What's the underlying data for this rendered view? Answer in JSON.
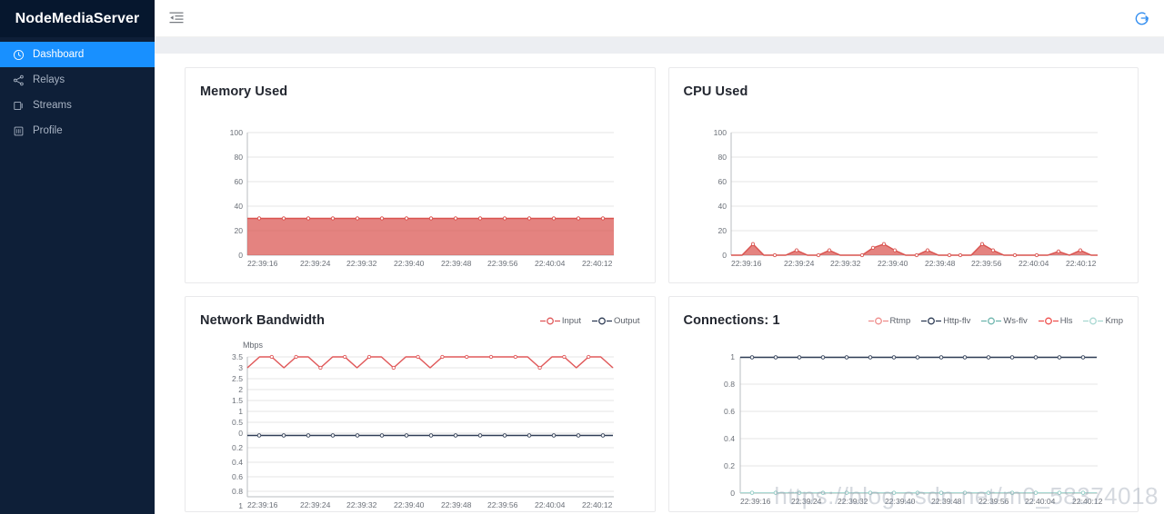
{
  "sidebar": {
    "brand": "NodeMediaServer",
    "items": [
      {
        "label": "Dashboard",
        "icon": "dashboard-icon",
        "active": true
      },
      {
        "label": "Relays",
        "icon": "share-icon",
        "active": false
      },
      {
        "label": "Streams",
        "icon": "window-icon",
        "active": false
      },
      {
        "label": "Profile",
        "icon": "id-card-icon",
        "active": false
      }
    ]
  },
  "topbar": {
    "collapse_icon": "menu-fold-icon",
    "logout_icon": "logout-icon",
    "accent_color": "#1890ff"
  },
  "watermark": "https://blog.csdn.net/m0_58374018",
  "colors": {
    "red": "#d9534f",
    "red_fill": "rgba(217,83,79,0.72)",
    "pink": "#ef8e8c",
    "navy": "#2f3d56",
    "teal": "#6fb6ae",
    "light_teal": "#a8d8d2",
    "orange_red": "#ef5350",
    "grid": "#e6e6e6",
    "sidebar_bg": "#0e1f38",
    "active_bg": "#1890ff"
  },
  "cards": [
    {
      "title": "Memory Used"
    },
    {
      "title": "CPU Used"
    },
    {
      "title": "Network Bandwidth"
    },
    {
      "title": "Connections: 1"
    }
  ],
  "chart_data": [
    {
      "id": "memory-used",
      "type": "area",
      "title": "Memory Used",
      "xlabel": "",
      "ylabel": "",
      "ylim": [
        0,
        100
      ],
      "yticks": [
        0,
        20,
        40,
        60,
        80,
        100
      ],
      "xtick_labels": [
        "22:39:16",
        "22:39:24",
        "22:39:32",
        "22:39:40",
        "22:39:48",
        "22:39:56",
        "22:40:04",
        "22:40:12"
      ],
      "grid": true,
      "legend": null,
      "series": [
        {
          "name": "Memory Used",
          "color": "#d9534f",
          "fill": "rgba(217,83,79,0.72)",
          "values": [
            30,
            30,
            30,
            30,
            30,
            30,
            30,
            30,
            30,
            30,
            30,
            30,
            30,
            30,
            30,
            30,
            30,
            30,
            30,
            30,
            30,
            30,
            30,
            30,
            30,
            30,
            30,
            30,
            30,
            30
          ]
        }
      ]
    },
    {
      "id": "cpu-used",
      "type": "area",
      "title": "CPU Used",
      "xlabel": "",
      "ylabel": "",
      "ylim": [
        0,
        100
      ],
      "yticks": [
        0,
        20,
        40,
        60,
        80,
        100
      ],
      "xtick_labels": [
        "22:39:16",
        "22:39:24",
        "22:39:32",
        "22:39:40",
        "22:39:48",
        "22:39:56",
        "22:40:04",
        "22:40:12"
      ],
      "grid": true,
      "legend": null,
      "series": [
        {
          "name": "CPU Used",
          "color": "#d9534f",
          "fill": "rgba(217,83,79,0.72)",
          "values": [
            0,
            0,
            0,
            9,
            0,
            0,
            4,
            0,
            0,
            4,
            0,
            0,
            0,
            6,
            9,
            4,
            0,
            0,
            4,
            0,
            0,
            0,
            0,
            9,
            4,
            0,
            0,
            0,
            0,
            0,
            3,
            0,
            4,
            0
          ]
        }
      ]
    },
    {
      "id": "network-bandwidth",
      "type": "line",
      "title": "Network Bandwidth",
      "xlabel": "",
      "ylabel": "Mbps",
      "yticks": [
        3.5,
        3,
        2.5,
        2,
        1.5,
        1,
        0.5,
        0,
        0.2,
        0.4,
        0.6,
        0.8,
        1
      ],
      "ytick_labels": [
        "3.5",
        "3",
        "2.5",
        "2",
        "1.5",
        "1",
        "0.5",
        "0",
        "0.2",
        "0.4",
        "0.6",
        "0.8",
        "1"
      ],
      "ylim": [
        -1,
        3.5
      ],
      "xtick_labels": [
        "22:39:16",
        "22:39:24",
        "22:39:32",
        "22:39:40",
        "22:39:48",
        "22:39:56",
        "22:40:04",
        "22:40:12"
      ],
      "grid": true,
      "legend": {
        "position": "top-right",
        "entries": [
          "Input",
          "Output"
        ]
      },
      "series": [
        {
          "name": "Input",
          "color": "#e0595a",
          "values": [
            3,
            3.5,
            3.5,
            3,
            3.5,
            3.5,
            3,
            3.5,
            3.5,
            3,
            3.5,
            3.5,
            3,
            3.5,
            3.5,
            3,
            3.5,
            3.5,
            3.5,
            3.5,
            3.5,
            3.5,
            3.5,
            3.5,
            3,
            3.5,
            3.5,
            3,
            3.5,
            3.5,
            3
          ]
        },
        {
          "name": "Output",
          "color": "#2f3d56",
          "values": [
            0,
            0,
            0,
            0,
            0,
            0,
            0,
            0,
            0,
            0,
            0,
            0,
            0,
            0,
            0,
            0,
            0,
            0,
            0,
            0,
            0,
            0,
            0,
            0,
            0,
            0,
            0,
            0,
            0,
            0,
            0
          ]
        }
      ]
    },
    {
      "id": "connections",
      "type": "line",
      "title": "Connections: 1",
      "xlabel": "",
      "ylabel": "",
      "ylim": [
        0,
        1
      ],
      "yticks": [
        0,
        0.2,
        0.4,
        0.6,
        0.8,
        1
      ],
      "ytick_labels": [
        "0",
        "0.2",
        "0.4",
        "0.6",
        "0.8",
        "1"
      ],
      "xtick_labels": [
        "22:39:16",
        "22:39:24",
        "22:39:32",
        "22:39:40",
        "22:39:48",
        "22:39:56",
        "22:40:04",
        "22:40:12"
      ],
      "grid": true,
      "legend": {
        "position": "top-right",
        "entries": [
          "Rtmp",
          "Http-flv",
          "Ws-flv",
          "Hls",
          "Kmp"
        ]
      },
      "series": [
        {
          "name": "Rtmp",
          "color": "#ef8e8c",
          "values": [
            0,
            0,
            0,
            0,
            0,
            0,
            0,
            0,
            0,
            0,
            0,
            0,
            0,
            0,
            0,
            0,
            0,
            0,
            0,
            0,
            0,
            0,
            0,
            0,
            0,
            0,
            0,
            0,
            0,
            0,
            0
          ]
        },
        {
          "name": "Http-flv",
          "color": "#2f3d56",
          "values": [
            1,
            1,
            1,
            1,
            1,
            1,
            1,
            1,
            1,
            1,
            1,
            1,
            1,
            1,
            1,
            1,
            1,
            1,
            1,
            1,
            1,
            1,
            1,
            1,
            1,
            1,
            1,
            1,
            1,
            1,
            1
          ]
        },
        {
          "name": "Ws-flv",
          "color": "#6fb6ae",
          "values": [
            0,
            0,
            0,
            0,
            0,
            0,
            0,
            0,
            0,
            0,
            0,
            0,
            0,
            0,
            0,
            0,
            0,
            0,
            0,
            0,
            0,
            0,
            0,
            0,
            0,
            0,
            0,
            0,
            0,
            0,
            0
          ]
        },
        {
          "name": "Hls",
          "color": "#ef5350",
          "values": [
            0,
            0,
            0,
            0,
            0,
            0,
            0,
            0,
            0,
            0,
            0,
            0,
            0,
            0,
            0,
            0,
            0,
            0,
            0,
            0,
            0,
            0,
            0,
            0,
            0,
            0,
            0,
            0,
            0,
            0,
            0
          ]
        },
        {
          "name": "Kmp",
          "color": "#a8d8d2",
          "values": [
            0,
            0,
            0,
            0,
            0,
            0,
            0,
            0,
            0,
            0,
            0,
            0,
            0,
            0,
            0,
            0,
            0,
            0,
            0,
            0,
            0,
            0,
            0,
            0,
            0,
            0,
            0,
            0,
            0,
            0,
            0
          ]
        }
      ]
    }
  ]
}
